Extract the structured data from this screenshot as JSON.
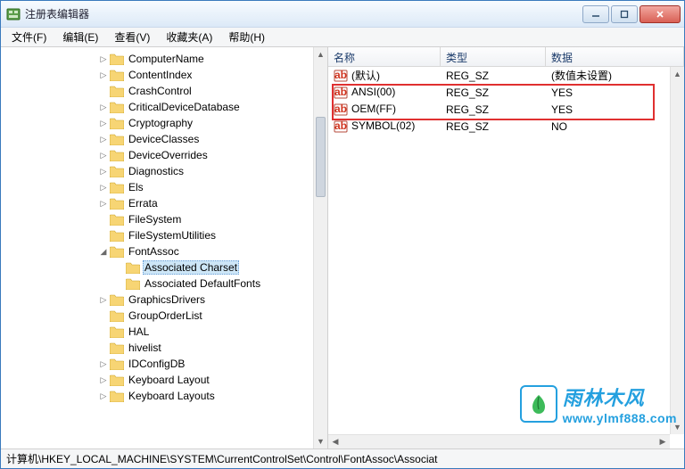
{
  "window": {
    "title": "注册表编辑器"
  },
  "menu": {
    "file": "文件(F)",
    "edit": "编辑(E)",
    "view": "查看(V)",
    "favorites": "收藏夹(A)",
    "help": "帮助(H)"
  },
  "tree": {
    "items": [
      {
        "indent": 6,
        "exp": "▷",
        "label": "ComputerName"
      },
      {
        "indent": 6,
        "exp": "▷",
        "label": "ContentIndex"
      },
      {
        "indent": 6,
        "exp": "",
        "label": "CrashControl"
      },
      {
        "indent": 6,
        "exp": "▷",
        "label": "CriticalDeviceDatabase"
      },
      {
        "indent": 6,
        "exp": "▷",
        "label": "Cryptography"
      },
      {
        "indent": 6,
        "exp": "▷",
        "label": "DeviceClasses"
      },
      {
        "indent": 6,
        "exp": "▷",
        "label": "DeviceOverrides"
      },
      {
        "indent": 6,
        "exp": "▷",
        "label": "Diagnostics"
      },
      {
        "indent": 6,
        "exp": "▷",
        "label": "Els"
      },
      {
        "indent": 6,
        "exp": "▷",
        "label": "Errata"
      },
      {
        "indent": 6,
        "exp": "",
        "label": "FileSystem"
      },
      {
        "indent": 6,
        "exp": "",
        "label": "FileSystemUtilities"
      },
      {
        "indent": 6,
        "exp": "◢",
        "label": "FontAssoc"
      },
      {
        "indent": 7,
        "exp": "",
        "label": "Associated Charset",
        "selected": true
      },
      {
        "indent": 7,
        "exp": "",
        "label": "Associated DefaultFonts"
      },
      {
        "indent": 6,
        "exp": "▷",
        "label": "GraphicsDrivers"
      },
      {
        "indent": 6,
        "exp": "",
        "label": "GroupOrderList"
      },
      {
        "indent": 6,
        "exp": "",
        "label": "HAL"
      },
      {
        "indent": 6,
        "exp": "",
        "label": "hivelist"
      },
      {
        "indent": 6,
        "exp": "▷",
        "label": "IDConfigDB"
      },
      {
        "indent": 6,
        "exp": "▷",
        "label": "Keyboard Layout"
      },
      {
        "indent": 6,
        "exp": "▷",
        "label": "Keyboard Layouts"
      }
    ]
  },
  "list": {
    "columns": {
      "name": "名称",
      "type": "类型",
      "data": "数据"
    },
    "colWidths": {
      "name": 126,
      "type": 118,
      "data": 130
    },
    "rows": [
      {
        "name": "(默认)",
        "type": "REG_SZ",
        "data": "(数值未设置)"
      },
      {
        "name": "ANSI(00)",
        "type": "REG_SZ",
        "data": "YES"
      },
      {
        "name": "OEM(FF)",
        "type": "REG_SZ",
        "data": "YES"
      },
      {
        "name": "SYMBOL(02)",
        "type": "REG_SZ",
        "data": "NO"
      }
    ]
  },
  "statusbar": {
    "path": "计算机\\HKEY_LOCAL_MACHINE\\SYSTEM\\CurrentControlSet\\Control\\FontAssoc\\Associat"
  },
  "watermark": {
    "text_cn": "雨林木风",
    "url": "www.ylmf888.com"
  }
}
